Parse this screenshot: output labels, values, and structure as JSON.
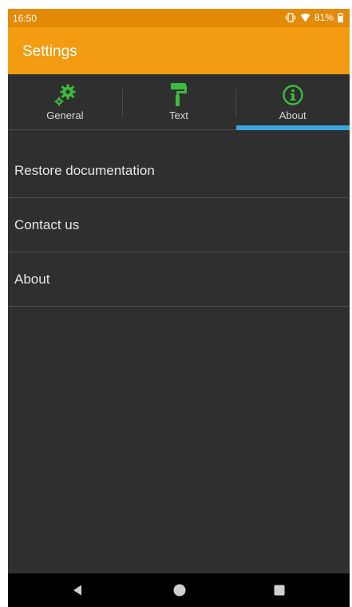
{
  "status_bar": {
    "time": "16:50",
    "battery_percent": "81%",
    "icons": [
      "vibrate-icon",
      "wifi-icon",
      "battery-icon"
    ]
  },
  "app_bar": {
    "title": "Settings"
  },
  "tabs": [
    {
      "label": "General",
      "icon": "gears-icon",
      "selected": false
    },
    {
      "label": "Text",
      "icon": "paint-roller-icon",
      "selected": false
    },
    {
      "label": "About",
      "icon": "info-icon",
      "selected": true
    }
  ],
  "list": {
    "items": [
      {
        "label": "Restore documentation"
      },
      {
        "label": "Contact us"
      },
      {
        "label": "About"
      }
    ]
  },
  "colors": {
    "status_bar": "#e38a07",
    "app_bar": "#f39c12",
    "background": "#2f2f2f",
    "tab_icon_green": "#3dbb3f",
    "tab_indicator": "#3aa6de"
  },
  "nav_bar": {
    "buttons": [
      "back-icon",
      "home-icon",
      "recents-icon"
    ]
  }
}
